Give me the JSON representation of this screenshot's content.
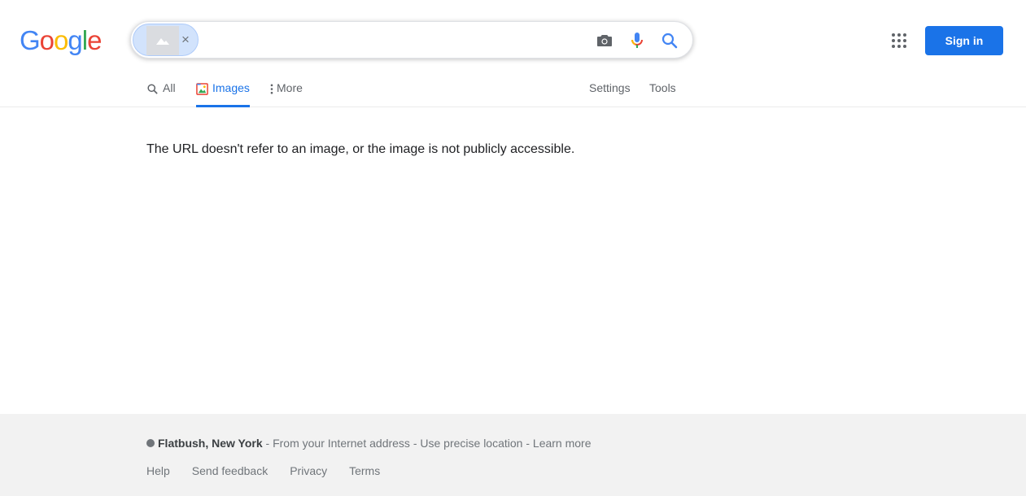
{
  "logo": {
    "letters": [
      "G",
      "o",
      "o",
      "g",
      "l",
      "e"
    ],
    "colors": [
      "#4285f4",
      "#ea4335",
      "#fbbc05",
      "#4285f4",
      "#34a853",
      "#ea4335"
    ]
  },
  "search": {
    "chip_close": "×",
    "camera_icon": "camera-icon",
    "mic_icon": "microphone-icon",
    "search_icon": "search-icon"
  },
  "header": {
    "apps_icon": "apps-grid-icon",
    "sign_in": "Sign in"
  },
  "tabs": [
    {
      "label": "All",
      "icon": "search-icon"
    },
    {
      "label": "Images",
      "icon": "image-icon",
      "active": true
    },
    {
      "label": "More",
      "icon": "more-vert-icon"
    },
    {
      "label": "Settings"
    },
    {
      "label": "Tools"
    }
  ],
  "main": {
    "message": "The URL doesn't refer to an image, or the image is not publicly accessible."
  },
  "footer": {
    "location": "Flatbush, New York",
    "sep1": " - ",
    "from_address": "From your Internet address",
    "sep2": " - ",
    "precise": "Use precise location",
    "sep3": " - ",
    "learn_more": "Learn more",
    "links": [
      "Help",
      "Send feedback",
      "Privacy",
      "Terms"
    ]
  },
  "colors": {
    "accent": "#1a73e8",
    "footer_bg": "#f2f2f2",
    "chip_bg": "#d2e3fc"
  }
}
